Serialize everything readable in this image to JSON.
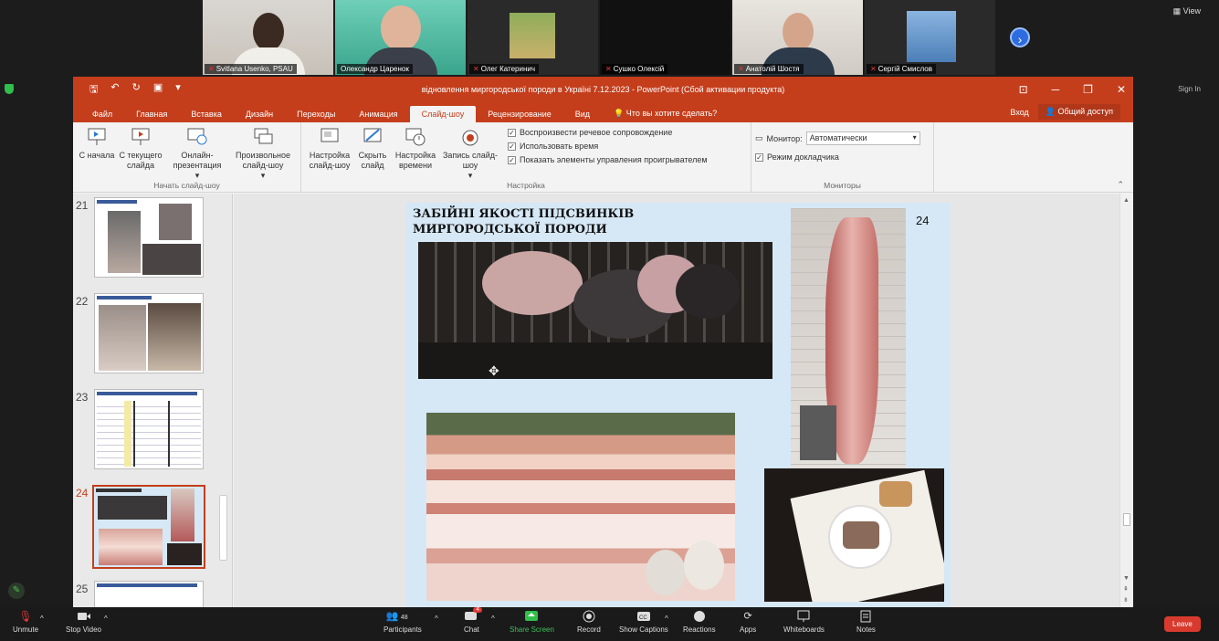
{
  "participants": [
    {
      "name": "Svitlana Usenko, PSAU",
      "muted": true
    },
    {
      "name": "Олександр Царенок",
      "muted": true
    },
    {
      "name": "Олег Катеринич",
      "muted": true
    },
    {
      "name": "Сушко Олексій",
      "muted": true
    },
    {
      "name": "Анатолій Шостя",
      "muted": true
    },
    {
      "name": "Сергій Смислов",
      "muted": true
    }
  ],
  "zoom": {
    "view_label": "View",
    "sign_in_label": "Sign In"
  },
  "ppt": {
    "window_title": "відновлення миргородської породи в Україні 7.12.2023 - PowerPoint (Сбой активации продукта)",
    "tabs": [
      "Файл",
      "Главная",
      "Вставка",
      "Дизайн",
      "Переходы",
      "Анимация",
      "Слайд-шоу",
      "Рецензирование",
      "Вид"
    ],
    "active_tab": "Слайд-шоу",
    "tell_me": "Что вы хотите сделать?",
    "sign_in": "Вход",
    "share": "Общий доступ",
    "ribbon": {
      "start_group": "Начать слайд-шоу",
      "from_beginning": "С начала",
      "from_current": "С текущего слайда",
      "online": "Онлайн-презентация",
      "custom": "Произвольное слайд-шоу",
      "setup_group": "Настройка",
      "setup": "Настройка слайд-шоу",
      "hide": "Скрыть слайд",
      "rehearse": "Настройка времени",
      "record": "Запись слайд-шоу",
      "check1": "Воспроизвести речевое сопровождение",
      "check2": "Использовать время",
      "check3": "Показать элементы управления проигрывателем",
      "monitors_group": "Мониторы",
      "monitor_label": "Монитор:",
      "monitor_value": "Автоматически",
      "presenter_view": "Режим докладчика"
    },
    "thumbnails": [
      {
        "num": "21"
      },
      {
        "num": "22"
      },
      {
        "num": "23"
      },
      {
        "num": "24",
        "selected": true
      },
      {
        "num": "25"
      }
    ],
    "slide": {
      "title_line1": "ЗАБІЙНІ ЯКОСТІ ПІДСВИНКІВ",
      "title_line2": "МИРГОРОДСЬКОЇ ПОРОДИ",
      "number": "24"
    }
  },
  "toolbar": {
    "unmute": "Unmute",
    "stop_video": "Stop Video",
    "participants": "Participants",
    "participants_count": "48",
    "chat": "Chat",
    "chat_badge": "4",
    "share_screen": "Share Screen",
    "record": "Record",
    "captions": "Show Captions",
    "reactions": "Reactions",
    "apps": "Apps",
    "whiteboards": "Whiteboards",
    "notes": "Notes",
    "leave": "Leave"
  }
}
